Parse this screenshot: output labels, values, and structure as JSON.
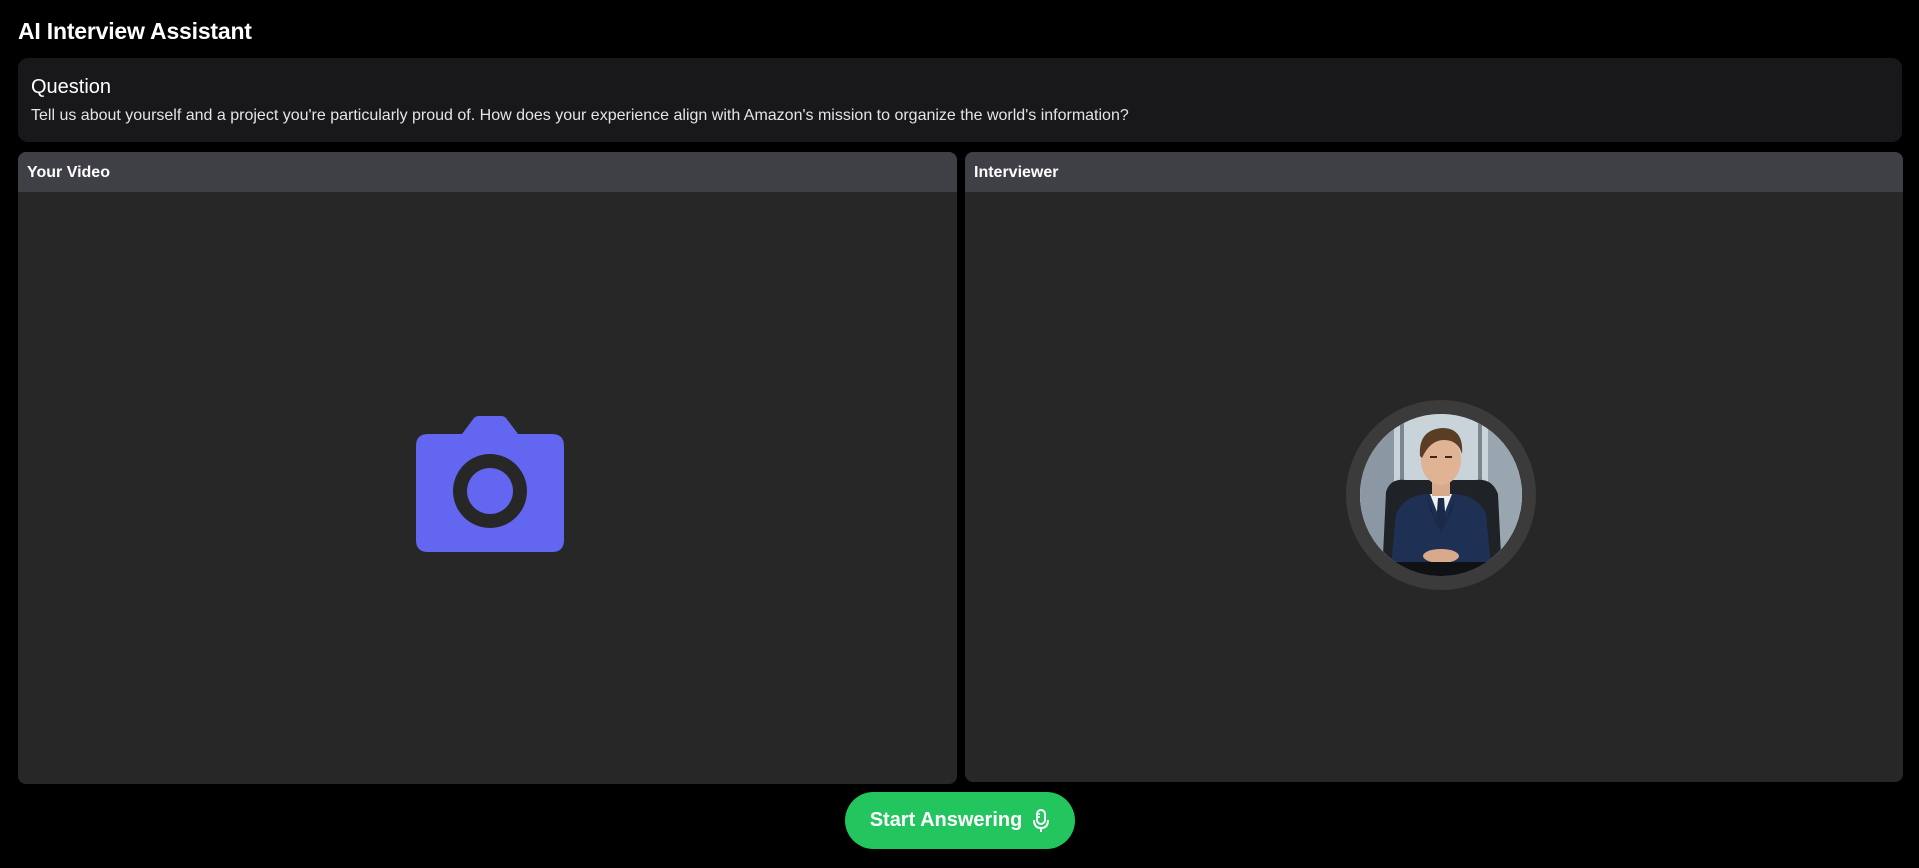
{
  "app": {
    "title": "AI Interview Assistant"
  },
  "question": {
    "heading": "Question",
    "text": "Tell us about yourself and a project you're particularly proud of. How does your experience align with Amazon's mission to organize the world's information?"
  },
  "panels": {
    "user_video": {
      "label": "Your Video",
      "placeholder_icon": "camera-icon"
    },
    "interviewer": {
      "label": "Interviewer",
      "avatar_icon": "interviewer-avatar"
    }
  },
  "actions": {
    "start_label": "Start Answering",
    "start_icon": "microphone-icon"
  },
  "colors": {
    "background": "#000000",
    "card": "#18181b",
    "panel": "#272727",
    "panel_header": "#3f3f46",
    "camera_accent": "#6366f1",
    "button": "#22c55e"
  }
}
